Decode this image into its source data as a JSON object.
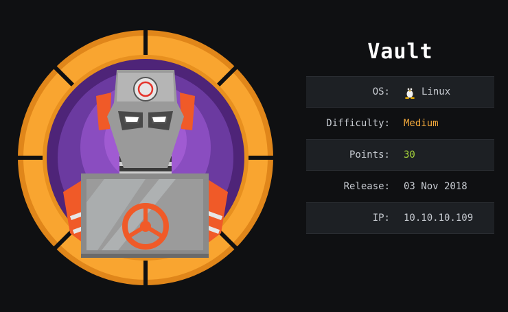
{
  "machine": {
    "name": "Vault",
    "avatar_icon": "robot-vault-icon"
  },
  "info": [
    {
      "key": "OS:",
      "value": "Linux",
      "icon": "linux-penguin-icon"
    },
    {
      "key": "Difficulty:",
      "value": "Medium",
      "color": "#f4a93b"
    },
    {
      "key": "Points:",
      "value": "30",
      "color": "#a5d33b"
    },
    {
      "key": "Release:",
      "value": "03 Nov 2018"
    },
    {
      "key": "IP:",
      "value": "10.10.10.109"
    }
  ],
  "colors": {
    "background": "#0f1012",
    "ring": "#f9a530",
    "inner": "#6b3aa0"
  }
}
